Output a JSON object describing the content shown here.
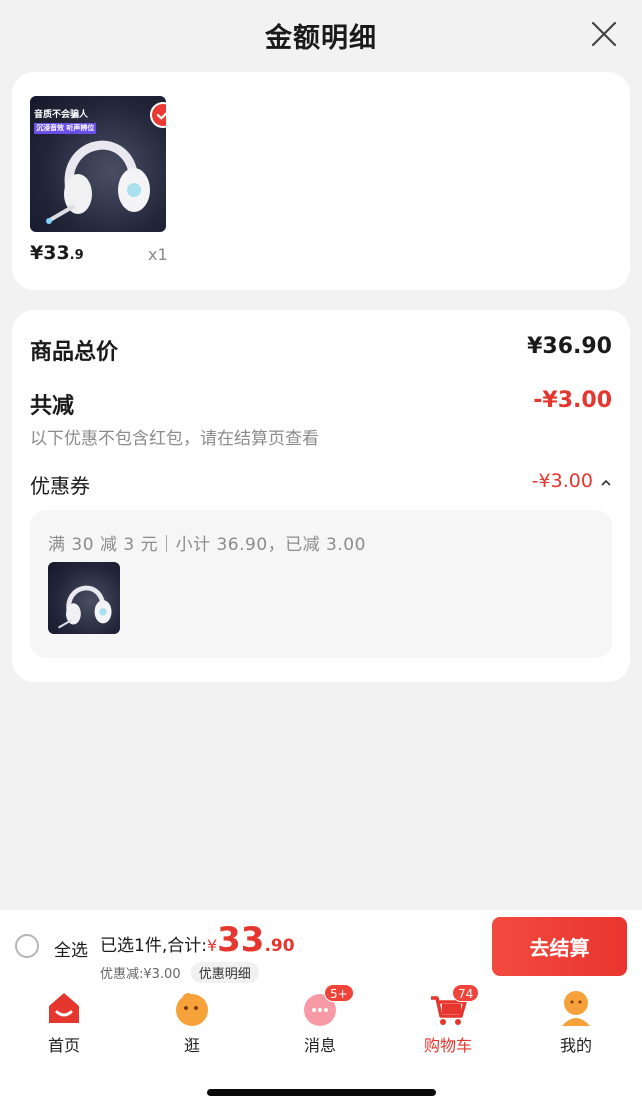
{
  "header": {
    "title": "金额明细"
  },
  "product": {
    "price_main": "¥33",
    "price_decimal": ".9",
    "quantity": "x1",
    "image_caption_line1": "音质不会骗人",
    "image_caption_tag": "沉浸音效 听声辨位"
  },
  "price_detail": {
    "total_label": "商品总价",
    "total_value": "¥36.90",
    "reduce_label": "共减",
    "reduce_value": "-¥3.00",
    "note": "以下优惠不包含红包，请在结算页查看",
    "coupon_label": "优惠券",
    "coupon_value": "-¥3.00",
    "coupon_desc": "满 30 减 3 元｜小计 36.90，已减 3.00"
  },
  "bottom_bar": {
    "select_all": "全选",
    "selected_text": "已选1件,合计:",
    "total_yen": "¥",
    "total_int": "33",
    "total_dec": ".90",
    "discount_text": "优惠减:¥3.00",
    "discount_detail": "优惠明细",
    "checkout": "去结算"
  },
  "tabbar": {
    "items": [
      {
        "label": "首页"
      },
      {
        "label": "逛"
      },
      {
        "label": "消息",
        "badge": "5+"
      },
      {
        "label": "购物车",
        "badge": "74"
      },
      {
        "label": "我的"
      }
    ]
  },
  "colors": {
    "accent": "#e5372e",
    "background": "#f2f2f2",
    "card": "#ffffff"
  }
}
